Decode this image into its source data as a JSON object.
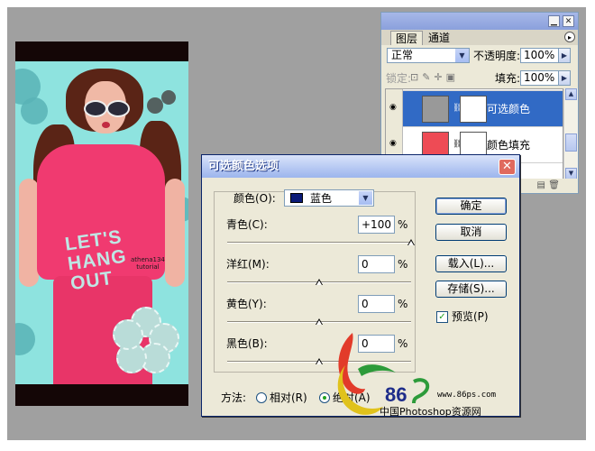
{
  "layers_panel": {
    "tabs": [
      "图层",
      "通道"
    ],
    "blend_mode": "正常",
    "opacity_label": "不透明度:",
    "opacity_value": "100%",
    "lock_label": "锁定:",
    "fill_label": "填充:",
    "fill_value": "100%",
    "layers": [
      {
        "name": "可选颜色",
        "selected": true
      },
      {
        "name": "颜色填充",
        "selected": false
      }
    ]
  },
  "canvas": {
    "watermark_line1": "athena134",
    "watermark_line2": "tutorial",
    "shirt_text": [
      "LET'S",
      "HANG",
      "OUT"
    ]
  },
  "dialog": {
    "title": "可选颜色选项",
    "color_label": "颜色(O):",
    "color_value": "蓝色",
    "color_swatch": "#0a1a78",
    "sliders": [
      {
        "label": "青色(C):",
        "value": "+100",
        "unit": "%",
        "level": 1.0
      },
      {
        "label": "洋红(M):",
        "value": "0",
        "unit": "%",
        "level": 0.5
      },
      {
        "label": "黄色(Y):",
        "value": "0",
        "unit": "%",
        "level": 0.5
      },
      {
        "label": "黑色(B):",
        "value": "0",
        "unit": "%",
        "level": 0.5
      }
    ],
    "buttons": {
      "ok": "确定",
      "cancel": "取消",
      "load": "载入(L)...",
      "save": "存储(S)..."
    },
    "preview_label": "预览(P)",
    "preview_checked": true,
    "method_label": "方法:",
    "method_relative": "相对(R)",
    "method_absolute": "绝对(A)",
    "method_selected": "absolute"
  },
  "logo": {
    "brand_number": "86",
    "url": "www.86ps.com",
    "tagline": "中国Photoshop资源网"
  }
}
